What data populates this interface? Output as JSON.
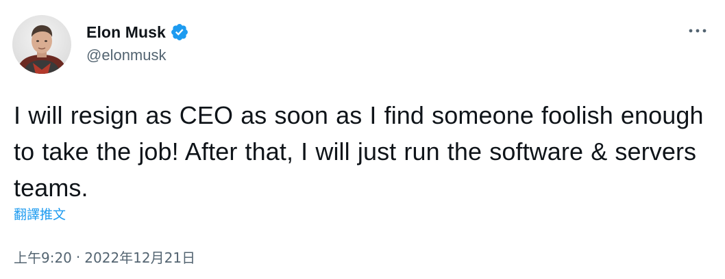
{
  "author": {
    "display_name": "Elon Musk",
    "handle": "@elonmusk",
    "verified": true,
    "verified_color": "#1d9bf0"
  },
  "tweet": {
    "text": "I will resign as CEO as soon as I find someone foolish enough to take the job! After that, I will just run the software & servers teams.",
    "translate_label": "翻譯推文",
    "time": "上午9:20",
    "separator": "·",
    "date": "2022年12月21日"
  },
  "icons": {
    "avatar": "avatar",
    "verified": "verified-badge-icon",
    "more": "more-options-icon"
  },
  "colors": {
    "link": "#1d9bf0",
    "secondary_text": "#536471",
    "primary_text": "#0f1419"
  }
}
